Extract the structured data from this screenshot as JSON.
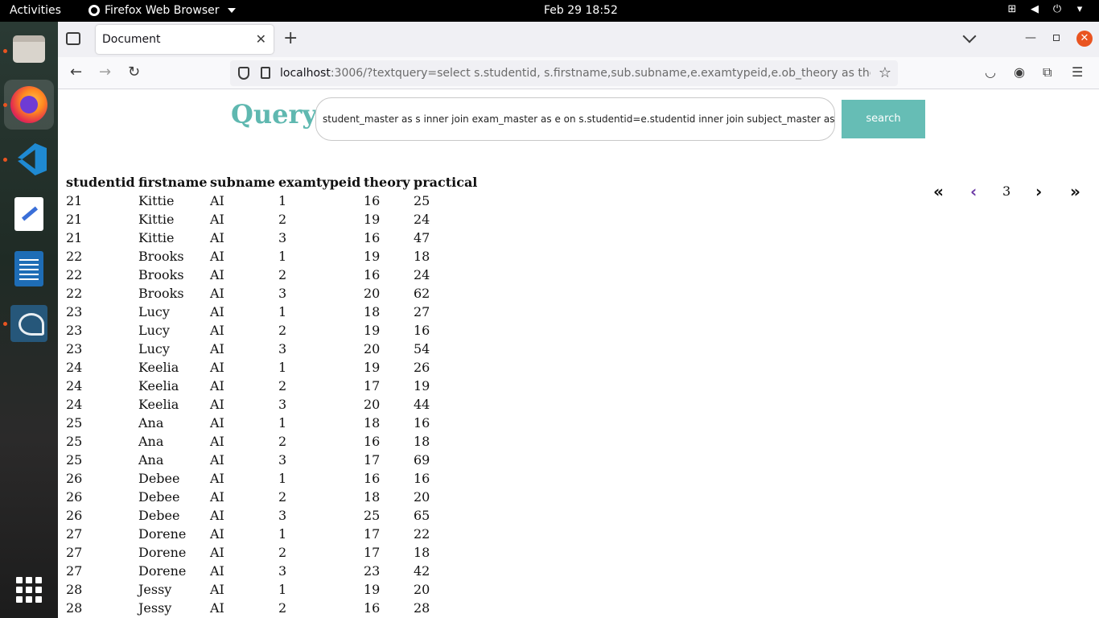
{
  "system": {
    "activities": "Activities",
    "app_name": "Firefox Web Browser",
    "clock": "Feb 29  18:52"
  },
  "dock": {
    "items": [
      "files-icon",
      "firefox-icon",
      "vscode-icon",
      "text-editor-icon",
      "libreoffice-writer-icon",
      "mysql-workbench-icon",
      "app-grid-icon"
    ]
  },
  "browser": {
    "tab_title": "Document",
    "url_host": "localhost",
    "url_rest": ":3006/?textquery=select s.studentid, s.firstname,sub.subname,e.examtypeid,e.ob_theory as theory"
  },
  "page": {
    "query_label": "Query",
    "query_value": "student_master as s inner join exam_master as e on s.studentid=e.studentid inner join subject_master as sub",
    "search_label": "search",
    "pager": {
      "first": "«",
      "prev": "‹",
      "current": "3",
      "next": "›",
      "last": "»"
    }
  },
  "table": {
    "columns": [
      "studentid",
      "firstname",
      "subname",
      "examtypeid",
      "theory",
      "practical"
    ],
    "rows": [
      [
        "21",
        "Kittie",
        "AI",
        "1",
        "16",
        "25"
      ],
      [
        "21",
        "Kittie",
        "AI",
        "2",
        "19",
        "24"
      ],
      [
        "21",
        "Kittie",
        "AI",
        "3",
        "16",
        "47"
      ],
      [
        "22",
        "Brooks",
        "AI",
        "1",
        "19",
        "18"
      ],
      [
        "22",
        "Brooks",
        "AI",
        "2",
        "16",
        "24"
      ],
      [
        "22",
        "Brooks",
        "AI",
        "3",
        "20",
        "62"
      ],
      [
        "23",
        "Lucy",
        "AI",
        "1",
        "18",
        "27"
      ],
      [
        "23",
        "Lucy",
        "AI",
        "2",
        "19",
        "16"
      ],
      [
        "23",
        "Lucy",
        "AI",
        "3",
        "20",
        "54"
      ],
      [
        "24",
        "Keelia",
        "AI",
        "1",
        "19",
        "26"
      ],
      [
        "24",
        "Keelia",
        "AI",
        "2",
        "17",
        "19"
      ],
      [
        "24",
        "Keelia",
        "AI",
        "3",
        "20",
        "44"
      ],
      [
        "25",
        "Ana",
        "AI",
        "1",
        "18",
        "16"
      ],
      [
        "25",
        "Ana",
        "AI",
        "2",
        "16",
        "18"
      ],
      [
        "25",
        "Ana",
        "AI",
        "3",
        "17",
        "69"
      ],
      [
        "26",
        "Debee",
        "AI",
        "1",
        "16",
        "16"
      ],
      [
        "26",
        "Debee",
        "AI",
        "2",
        "18",
        "20"
      ],
      [
        "26",
        "Debee",
        "AI",
        "3",
        "25",
        "65"
      ],
      [
        "27",
        "Dorene",
        "AI",
        "1",
        "17",
        "22"
      ],
      [
        "27",
        "Dorene",
        "AI",
        "2",
        "17",
        "18"
      ],
      [
        "27",
        "Dorene",
        "AI",
        "3",
        "23",
        "42"
      ],
      [
        "28",
        "Jessy",
        "AI",
        "1",
        "19",
        "20"
      ],
      [
        "28",
        "Jessy",
        "AI",
        "2",
        "16",
        "28"
      ]
    ]
  },
  "colors": {
    "accent": "#5fb8b0",
    "search_button": "#66bdb5",
    "close_button": "#e95420",
    "pager_prev": "#6c3aa6"
  }
}
